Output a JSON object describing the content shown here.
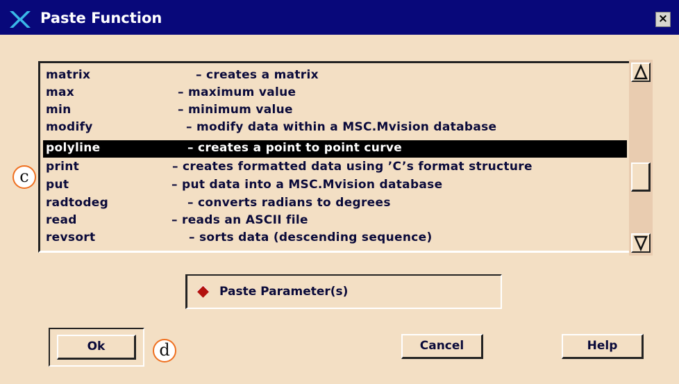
{
  "window": {
    "title": "Paste Function",
    "close_label": "×"
  },
  "function_list": {
    "items": [
      {
        "name": "matrix",
        "desc": "– creates a matrix",
        "selected": false
      },
      {
        "name": "max",
        "desc": "– maximum value",
        "selected": false
      },
      {
        "name": "min",
        "desc": "– minimum value",
        "selected": false
      },
      {
        "name": "modify",
        "desc": "– modify data within a MSC.Mvision database",
        "selected": false
      },
      {
        "name": "polyline",
        "desc": "– creates a point to point curve",
        "selected": true
      },
      {
        "name": "print",
        "desc": "– creates formatted data using ’C’s format structure",
        "selected": false
      },
      {
        "name": "put",
        "desc": "– put data into a MSC.Mvision database",
        "selected": false
      },
      {
        "name": "radtodeg",
        "desc": "– converts radians to degrees",
        "selected": false
      },
      {
        "name": "read",
        "desc": "– reads an ASCII file",
        "selected": false
      },
      {
        "name": "revsort",
        "desc": "– sorts data (descending sequence)",
        "selected": false
      }
    ]
  },
  "scrollbar": {
    "up_icon": "arrow-up-icon",
    "down_icon": "arrow-down-icon",
    "thumb_position": 0.55
  },
  "options": {
    "paste_parameters_label": "Paste Parameter(s)",
    "paste_parameters_selected": true,
    "accent_color": "#b3120f"
  },
  "buttons": {
    "ok_label": "Ok",
    "cancel_label": "Cancel",
    "help_label": "Help"
  },
  "annotations": {
    "c": "c",
    "d": "d"
  },
  "colors": {
    "titlebar": "#08087a",
    "background": "#f3dfc4",
    "selection": "#000000"
  }
}
